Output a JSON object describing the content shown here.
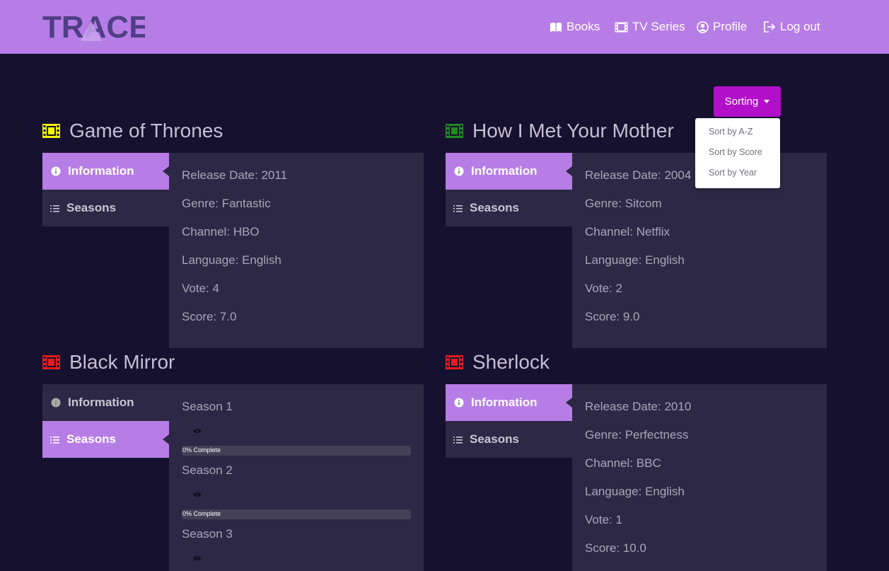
{
  "brand": "TRACE",
  "nav": {
    "books": "Books",
    "tv_series": "TV Series",
    "profile": "Profile",
    "logout": "Log out"
  },
  "sorting": {
    "label": "Sorting",
    "options": [
      "Sort by A-Z",
      "Sort by Score",
      "Sort by Year"
    ]
  },
  "tabs": {
    "information": "Information",
    "seasons": "Seasons"
  },
  "series": [
    {
      "title": "Game of Thrones",
      "icon_color": "#f5f500",
      "active_tab": "information",
      "info": [
        "Release Date: 2011",
        "Genre: Fantastic",
        "Channel: HBO",
        "Language: English",
        "Vote: 4",
        "Score: 7.0"
      ]
    },
    {
      "title": "How I Met Your Mother",
      "icon_color": "#1e8c1e",
      "active_tab": "information",
      "info": [
        "Release Date: 2004",
        "Genre: Sitcom",
        "Channel: Netflix",
        "Language: English",
        "Vote: 2",
        "Score: 9.0"
      ]
    },
    {
      "title": "Black Mirror",
      "icon_color": "#e81c1c",
      "active_tab": "seasons",
      "seasons": [
        {
          "name": "Season 1",
          "progress_label": "0% Complete",
          "progress": 0
        },
        {
          "name": "Season 2",
          "progress_label": "0% Complete",
          "progress": 0
        },
        {
          "name": "Season 3"
        }
      ]
    },
    {
      "title": "Sherlock",
      "icon_color": "#e81c1c",
      "active_tab": "information",
      "info": [
        "Release Date: 2010",
        "Genre: Perfectness",
        "Channel: BBC",
        "Language: English",
        "Vote: 1",
        "Score: 10.0"
      ]
    }
  ]
}
